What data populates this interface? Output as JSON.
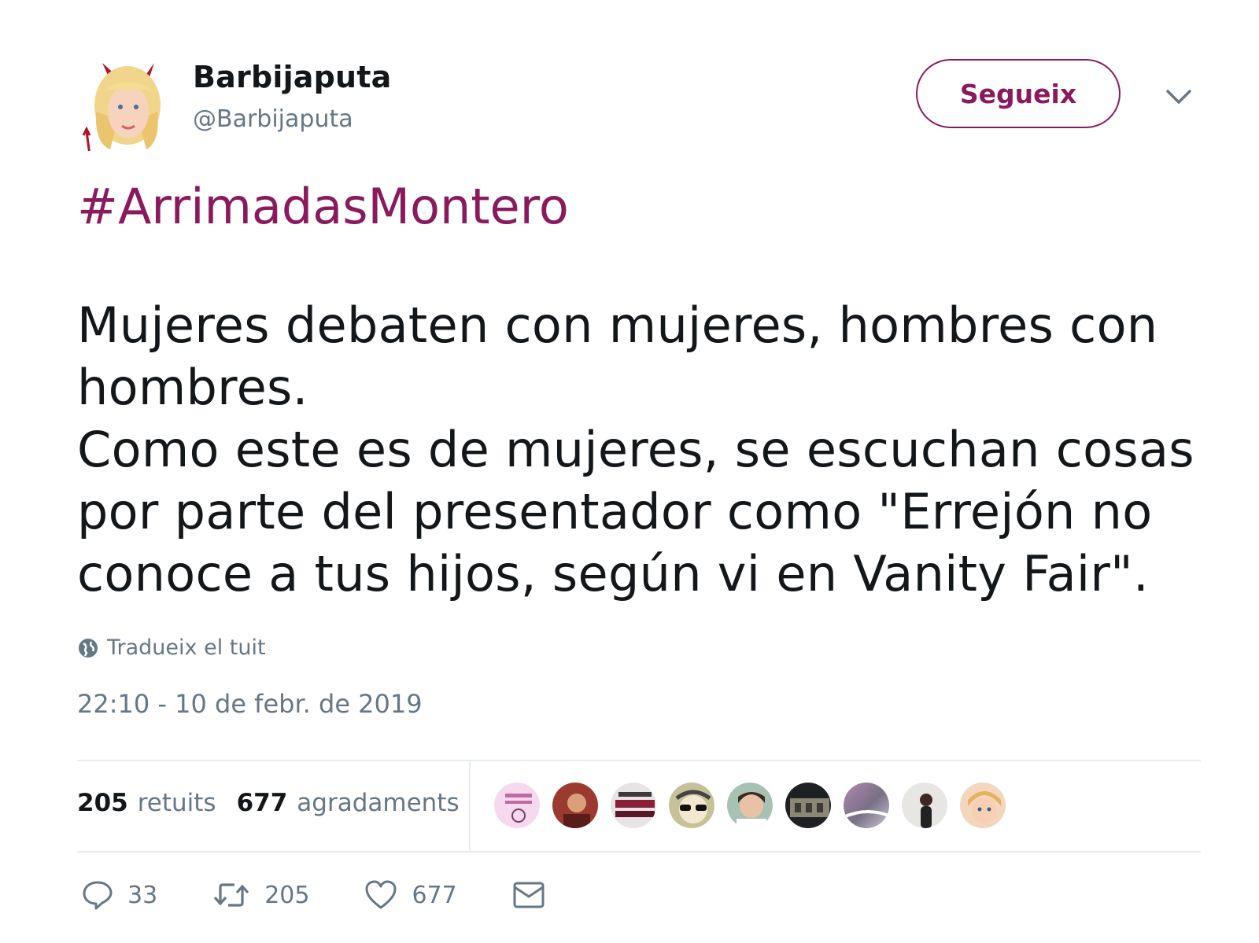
{
  "user": {
    "name": "Barbijaputa",
    "handle": "@Barbijaputa"
  },
  "follow_label": "Segueix",
  "tweet": {
    "hashtag": "#ArrimadasMontero",
    "text": "Mujeres debaten con mujeres, hombres con hombres.\nComo este es de mujeres, se escuchan cosas por parte del presentador como \"Errejón no conoce a tus hijos, según vi en Vanity Fair\".",
    "translate_label": "Tradueix el tuit",
    "timestamp": "22:10 - 10 de febr. de 2019"
  },
  "stats": {
    "retweets_count": "205",
    "retweets_label": "retuits",
    "likes_count": "677",
    "likes_label": "agradaments"
  },
  "actions": {
    "replies": "33",
    "retweets": "205",
    "likes": "677"
  },
  "colors": {
    "accent": "#8a1a5e",
    "muted": "#657786",
    "text": "#14171a"
  }
}
